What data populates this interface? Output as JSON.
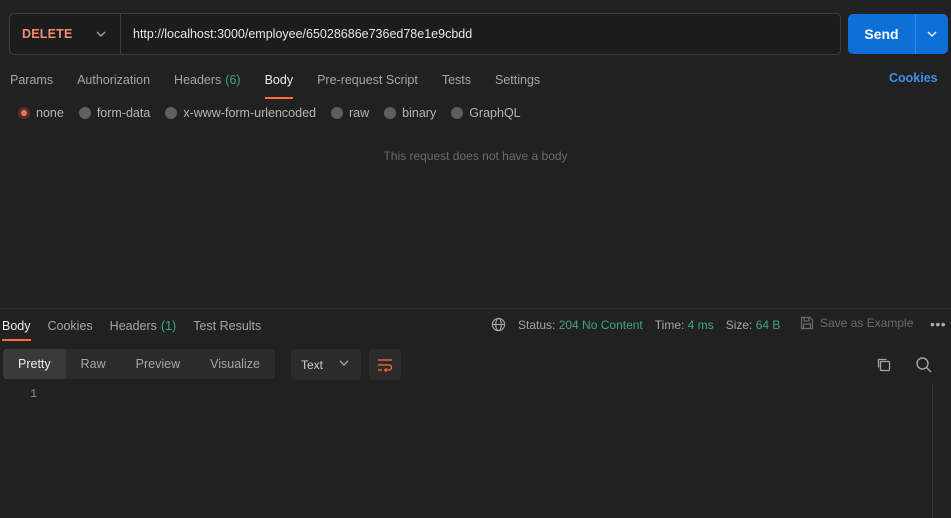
{
  "request": {
    "method": "DELETE",
    "url": "http://localhost:3000/employee/65028686e736ed78e1e9cbdd",
    "send_label": "Send",
    "tabs": [
      {
        "label": "Params"
      },
      {
        "label": "Authorization"
      },
      {
        "label": "Headers",
        "count": "(6)"
      },
      {
        "label": "Body",
        "active": true
      },
      {
        "label": "Pre-request Script"
      },
      {
        "label": "Tests"
      },
      {
        "label": "Settings"
      }
    ],
    "cookies_label": "Cookies",
    "body_types": [
      "none",
      "form-data",
      "x-www-form-urlencoded",
      "raw",
      "binary",
      "GraphQL"
    ],
    "selected_body_type": "none",
    "empty_body_message": "This request does not have a body"
  },
  "response": {
    "tabs": [
      {
        "label": "Body",
        "active": true
      },
      {
        "label": "Cookies"
      },
      {
        "label": "Headers",
        "count": "(1)"
      },
      {
        "label": "Test Results"
      }
    ],
    "status_label": "Status:",
    "status_value": "204 No Content",
    "time_label": "Time:",
    "time_value": "4 ms",
    "size_label": "Size:",
    "size_value": "64 B",
    "save_example_label": "Save as Example",
    "more_label": "•••",
    "view_modes": [
      "Pretty",
      "Raw",
      "Preview",
      "Visualize"
    ],
    "active_view": "Pretty",
    "format": "Text",
    "line_number": "1"
  },
  "colors": {
    "method": "#f48b70",
    "send": "#0f6fd9",
    "active_tab_underline": "#ff6c37",
    "status_good": "#3fa87c",
    "cookies_link": "#3d8fe8"
  },
  "icons": {
    "method_dropdown": "chevron-down-icon",
    "send_dropdown": "chevron-down-icon",
    "network": "globe-icon",
    "save": "save-icon",
    "wrap": "wrap-lines-icon",
    "copy": "copy-icon",
    "search": "search-icon"
  }
}
